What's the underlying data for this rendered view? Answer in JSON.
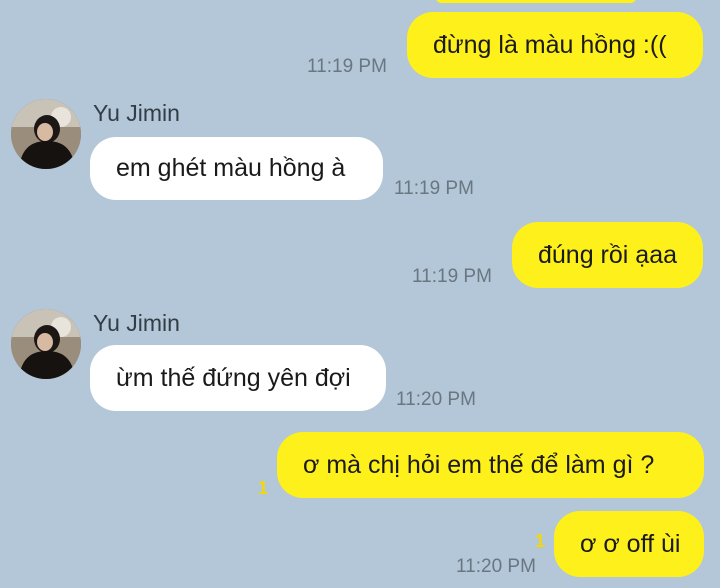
{
  "theme": {
    "background": "#b3c7d9",
    "my_bubble_color": "#fef01b",
    "their_bubble_color": "#ffffff",
    "unread_color": "#f2d80a"
  },
  "messages": [
    {
      "from": "me",
      "text": "đừng là màu hồng :((",
      "time": "11:19 PM"
    },
    {
      "from": "them",
      "sender": "Yu Jimin",
      "text": "em ghét màu hồng à",
      "time": "11:19 PM"
    },
    {
      "from": "me",
      "text": "đúng rồi ạaa",
      "time": "11:19 PM"
    },
    {
      "from": "them",
      "sender": "Yu Jimin",
      "text": "ừm thế đứng yên đợi",
      "time": "11:20 PM"
    },
    {
      "from": "me",
      "text": "ơ mà chị hỏi em thế để làm gì ?",
      "unread": "1"
    },
    {
      "from": "me",
      "text": "ơ ơ off ùi",
      "time": "11:20 PM",
      "unread": "1"
    }
  ]
}
